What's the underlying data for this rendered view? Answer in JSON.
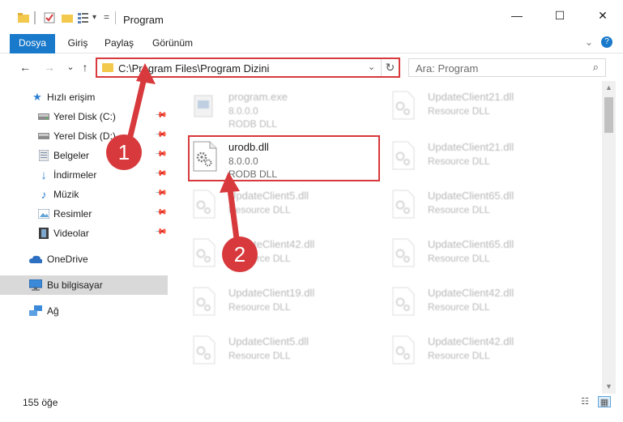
{
  "window": {
    "title": "Program",
    "minimize": "—",
    "maximize": "☐",
    "close": "✕"
  },
  "ribbon": {
    "tabs": [
      "Dosya",
      "Giriş",
      "Paylaş",
      "Görünüm"
    ],
    "expand": "⌄",
    "help": "?"
  },
  "nav": {
    "back": "←",
    "forward": "→",
    "recent": "⌄",
    "up": "↑",
    "address": "C:\\Program Files\\Program Dizini",
    "address_dropdown": "⌄",
    "refresh": "↻",
    "search_placeholder": "Ara: Program",
    "search_icon": "⌕"
  },
  "sidebar": {
    "items": [
      {
        "label": "Hızlı erişim",
        "icon": "star-icon",
        "pinned": false
      },
      {
        "label": "Yerel Disk (C:)",
        "icon": "drive-icon",
        "pinned": true
      },
      {
        "label": "Yerel Disk (D:)",
        "icon": "drive-icon",
        "pinned": true
      },
      {
        "label": "Belgeler",
        "icon": "documents-icon",
        "pinned": true
      },
      {
        "label": "İndirmeler",
        "icon": "download-icon",
        "pinned": true
      },
      {
        "label": "Müzik",
        "icon": "music-icon",
        "pinned": true
      },
      {
        "label": "Resimler",
        "icon": "pictures-icon",
        "pinned": true
      },
      {
        "label": "Videolar",
        "icon": "videos-icon",
        "pinned": true
      },
      {
        "label": "OneDrive",
        "icon": "cloud-icon",
        "pinned": false
      },
      {
        "label": "Bu bilgisayar",
        "icon": "computer-icon",
        "pinned": false,
        "selected": true
      },
      {
        "label": "Ağ",
        "icon": "network-icon",
        "pinned": false
      }
    ]
  },
  "files": [
    {
      "name": "program.exe",
      "line2": "8.0.0.0",
      "line3": "RODB DLL"
    },
    {
      "name": "urodb.dll",
      "line2": "8.0.0.0",
      "line3": "RODB DLL",
      "highlighted": true
    },
    {
      "name": "UpdateClient5.dll",
      "line2": "Resource DLL"
    },
    {
      "name": "UpdateClient42.dll",
      "line2": "Resource DLL"
    },
    {
      "name": "UpdateClient19.dll",
      "line2": "Resource DLL"
    },
    {
      "name": "UpdateClient5.dll",
      "line2": "Resource DLL"
    },
    {
      "name": "UpdateClient21.dll",
      "line2": "Resource DLL"
    },
    {
      "name": "UpdateClient21.dll",
      "line2": "Resource DLL"
    },
    {
      "name": "UpdateClient65.dll",
      "line2": "Resource DLL"
    },
    {
      "name": "UpdateClient65.dll",
      "line2": "Resource DLL"
    },
    {
      "name": "UpdateClient42.dll",
      "line2": "Resource DLL"
    },
    {
      "name": "UpdateClient42.dll",
      "line2": "Resource DLL"
    }
  ],
  "status": {
    "item_count": "155 öğe"
  },
  "callouts": {
    "one": "1",
    "two": "2"
  },
  "colors": {
    "accent": "#1979ca",
    "highlight_red": "#d7393c",
    "selected_bg": "#d9d9d9"
  }
}
